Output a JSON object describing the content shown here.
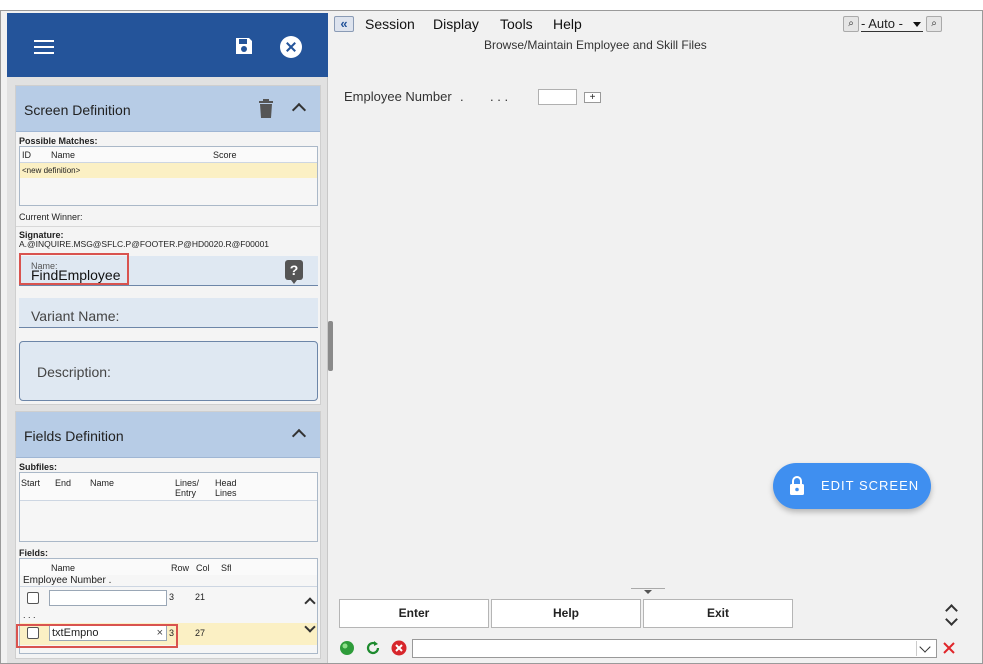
{
  "left_panel": {
    "screen_definition": {
      "title": "Screen Definition",
      "possible_matches_label": "Possible Matches:",
      "columns": [
        "ID",
        "Name",
        "Score"
      ],
      "rows": [
        "<new definition>"
      ],
      "current_winner_label": "Current Winner:",
      "signature_label": "Signature:",
      "signature_value": "A.@INQUIRE.MSG@SFLC.P@FOOTER.P@HD0020.R@F00001",
      "name_label": "Name:",
      "name_value": "FindEmployee",
      "variant_name_label": "Variant Name:",
      "description_label": "Description:"
    },
    "fields_definition": {
      "title": "Fields Definition",
      "subfiles_label": "Subfiles:",
      "subfile_columns": [
        "Start",
        "End",
        "Name",
        "Lines/ Entry",
        "Head Lines"
      ],
      "fields_label": "Fields:",
      "field_columns": [
        "Name",
        "Row",
        "Col",
        "Sfl"
      ],
      "partial_row_text": "Employee Number .",
      "rows": [
        {
          "name": "",
          "row": "3",
          "col": "21"
        },
        {
          "name": "txtEmpno",
          "row": "3",
          "col": "27"
        }
      ],
      "ellipsis": ". . .",
      "clear_glyph": "×"
    }
  },
  "menu": {
    "back_glyph": "«",
    "items": [
      "Session",
      "Display",
      "Tools",
      "Help"
    ],
    "zoom_glyph": "⌕",
    "auto_select": "- Auto -"
  },
  "screen": {
    "subtitle": "Browse/Maintain Employee and Skill Files",
    "employee_number_label": "Employee Number",
    "dot1": ".",
    "dots": ". . .",
    "plus": "+"
  },
  "edit_screen_label": "EDIT SCREEN",
  "function_keys": [
    "Enter",
    "Help",
    "Exit"
  ],
  "colors": {
    "brand": "#24549a",
    "card_header": "#b7cce6",
    "accent_button": "#3f8ff0",
    "highlight_row": "#fbf0c4",
    "red_outline": "#d9534f"
  }
}
